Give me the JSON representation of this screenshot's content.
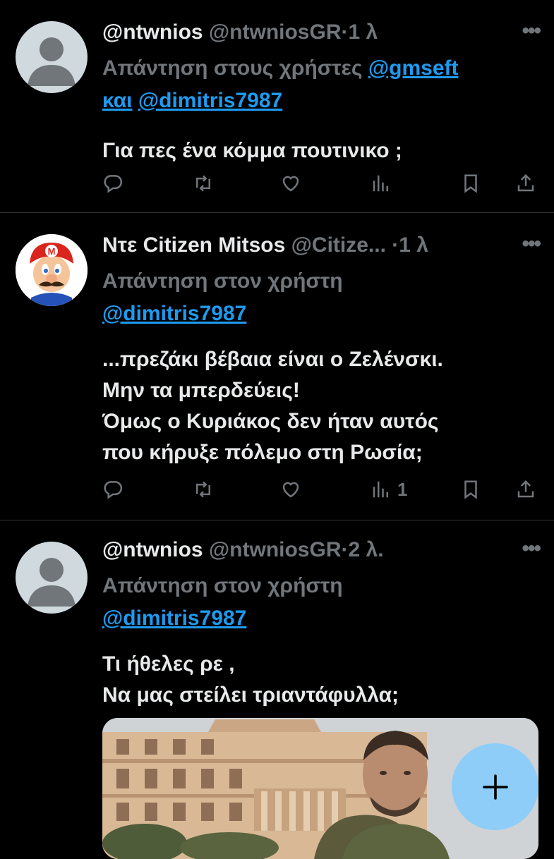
{
  "tweets": [
    {
      "name": "@ntwnios",
      "handle": "@ntwniosGR",
      "time": "1 λ",
      "replying_prefix": "Απάντηση στους χρήστες",
      "mention1": "@gmseft",
      "connector": "και",
      "mention2": "@dimitris7987",
      "text_lines": [
        "Για πες ένα κόμμα πουτινικο ;"
      ],
      "views": ""
    },
    {
      "name": "Ντε Citizen Mitsos",
      "handle": "@Citize...",
      "time": "1 λ",
      "replying_prefix": "Απάντηση στον χρήστη",
      "mention1": "@dimitris7987",
      "text_lines": [
        "...πρεζάκι βέβαια είναι ο Ζελένσκι.",
        "Μην τα μπερδεύεις!",
        "Όμως ο Κυριάκος δεν ήταν αυτός",
        "που κήρυξε πόλεμο στη Ρωσία;"
      ],
      "views": "1"
    },
    {
      "name": "@ntwnios",
      "handle": "@ntwniosGR",
      "time": "2 λ.",
      "replying_prefix": "Απάντηση στον χρήστη",
      "mention1": "@dimitris7987",
      "text_lines": [
        "Τι ήθελες ρε ,",
        "Να μας στείλει τριαντάφυλλα;"
      ]
    }
  ],
  "separator": "·",
  "more_label": "•••",
  "icons": [
    "reply-icon",
    "retweet-icon",
    "like-icon",
    "views-icon",
    "bookmark-icon",
    "share-icon",
    "compose-icon"
  ],
  "colors": {
    "background": "#000000",
    "link": "#1d9bf0",
    "muted": "#71767b",
    "fab": "#8ecdf8"
  }
}
